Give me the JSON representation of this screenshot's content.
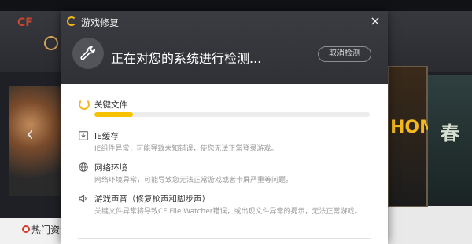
{
  "background": {
    "news_label": "热门资讯",
    "brand": "CF",
    "right_banner_text": "HOM",
    "right_banner2_text": "春"
  },
  "dialog": {
    "title": "游戏修复",
    "close_glyph": "×",
    "status_text": "正在对您的系统进行检测...",
    "cancel_label": "取消检测"
  },
  "items": [
    {
      "title": "关键文件",
      "desc": "",
      "icon": "spinner-icon",
      "progress": 0.14
    },
    {
      "title": "IE缓存",
      "desc": "IE组件异常，可能导致未知错误，使您无法正常登录游戏。",
      "icon": "download-box-icon"
    },
    {
      "title": "网络环境",
      "desc": "网络环境异常，可能导致您无法正常游戏或者卡屏严重等问题。",
      "icon": "globe-icon"
    },
    {
      "title": "游戏声音（修复枪声和脚步声）",
      "desc": "关键文件异常将导致CF File Watcher错误，或出现文件异常的提示，无法正常游戏。",
      "icon": "speaker-icon"
    }
  ],
  "colors": {
    "accent": "#f6c200",
    "header_bg": "#35363b"
  }
}
